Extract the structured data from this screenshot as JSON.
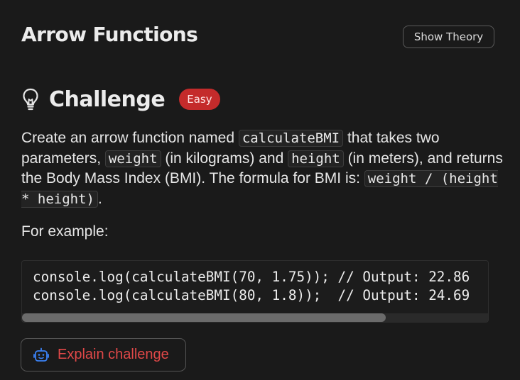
{
  "header": {
    "title": "Arrow Functions",
    "show_theory_label": "Show Theory"
  },
  "challenge": {
    "icon": "lightbulb-icon",
    "title": "Challenge",
    "difficulty": "Easy",
    "difficulty_color": "#c42b2b",
    "description": {
      "p1": "Create an arrow function named ",
      "code1": "calculateBMI",
      "p2": " that takes two parameters, ",
      "code2": "weight",
      "p3": " (in kilograms) and ",
      "code3": "height",
      "p4": " (in meters), and returns the Body Mass Index (BMI). The formula for BMI is: ",
      "code4": "weight / (height * height)",
      "p5": "."
    },
    "example_label": "For example:",
    "code_lines": [
      "console.log(calculateBMI(70, 1.75)); // Output: 22.86",
      "console.log(calculateBMI(80, 1.8));  // Output: 24.69"
    ],
    "code_scroll_visible_fraction": 0.78
  },
  "explain": {
    "icon": "bot-icon",
    "label": "Explain challenge",
    "accent_color": "#e04848"
  }
}
